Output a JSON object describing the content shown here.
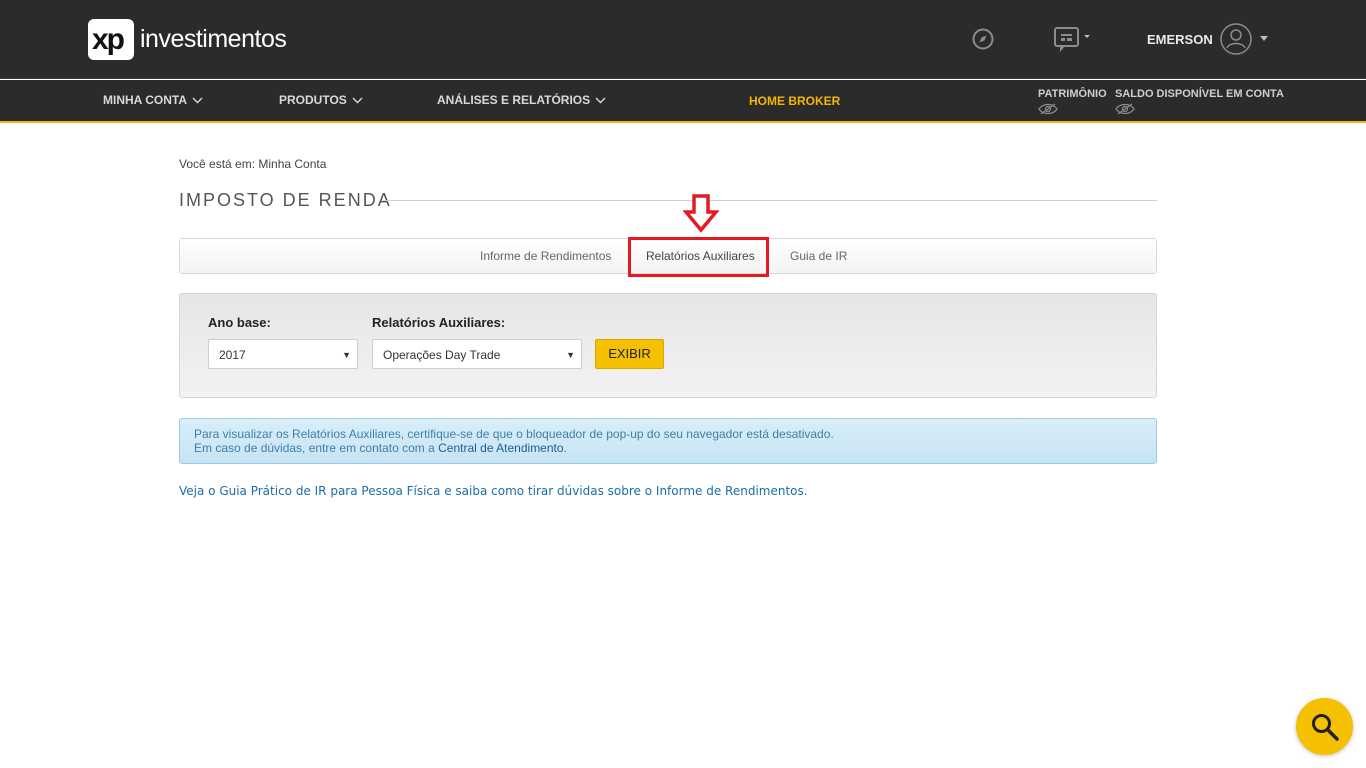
{
  "header": {
    "logo_mark": "xp",
    "logo_text": "investimentos",
    "username": "EMERSON"
  },
  "nav": {
    "items": [
      "MINHA CONTA",
      "PRODUTOS",
      "ANÁLISES E RELATÓRIOS"
    ],
    "home_broker": "HOME BROKER",
    "patrimonio": "PATRIMÔNIO",
    "saldo": "SALDO DISPONÍVEL EM CONTA",
    "accent": "#f5b800"
  },
  "breadcrumb": "Você está em: Minha Conta",
  "page_title": "IMPOSTO DE RENDA",
  "tabs": [
    "Informe de Rendimentos",
    "Relatórios Auxiliares",
    "Guia de IR"
  ],
  "active_tab": "Relatórios Auxiliares",
  "filters": {
    "ano_label": "Ano base:",
    "ano_value": "2017",
    "rel_label": "Relatórios Auxiliares:",
    "rel_value": "Operações Day Trade",
    "exibir": "EXIBIR"
  },
  "alert": {
    "line1": "Para visualizar os Relatórios Auxiliares, certifique-se de que o bloqueador de pop-up do seu navegador está desativado.",
    "line2_prefix": "Em caso de dúvidas, entre em contato com a ",
    "line2_link": "Central de Atendimento",
    "line2_suffix": "."
  },
  "guide_link": "Veja o Guia Prático de IR para Pessoa Física e saiba como tirar dúvidas sobre o Informe de Rendimentos.",
  "icons": {
    "compass": "compass-icon",
    "chat": "chat-icon",
    "avatar": "user-avatar-icon",
    "eye": "eye-hidden-icon",
    "search": "search-icon",
    "arrow": "down-arrow-icon"
  }
}
